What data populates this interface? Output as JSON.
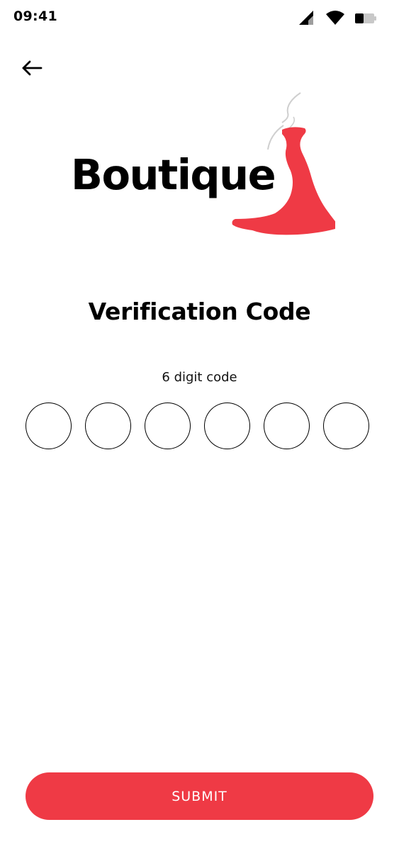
{
  "status_bar": {
    "time": "09:41",
    "icons": [
      "cellular-signal-icon",
      "wifi-icon",
      "battery-icon"
    ]
  },
  "nav": {
    "back_icon": "arrow-left-icon"
  },
  "logo": {
    "text": "Boutique",
    "dress_color": "#ef3a45"
  },
  "title": "Verification Code",
  "code": {
    "caption": "6 digit code",
    "digits": [
      "",
      "",
      "",
      "",
      "",
      ""
    ]
  },
  "submit": {
    "label": "SUBMIT",
    "color": "#ef3a45"
  }
}
